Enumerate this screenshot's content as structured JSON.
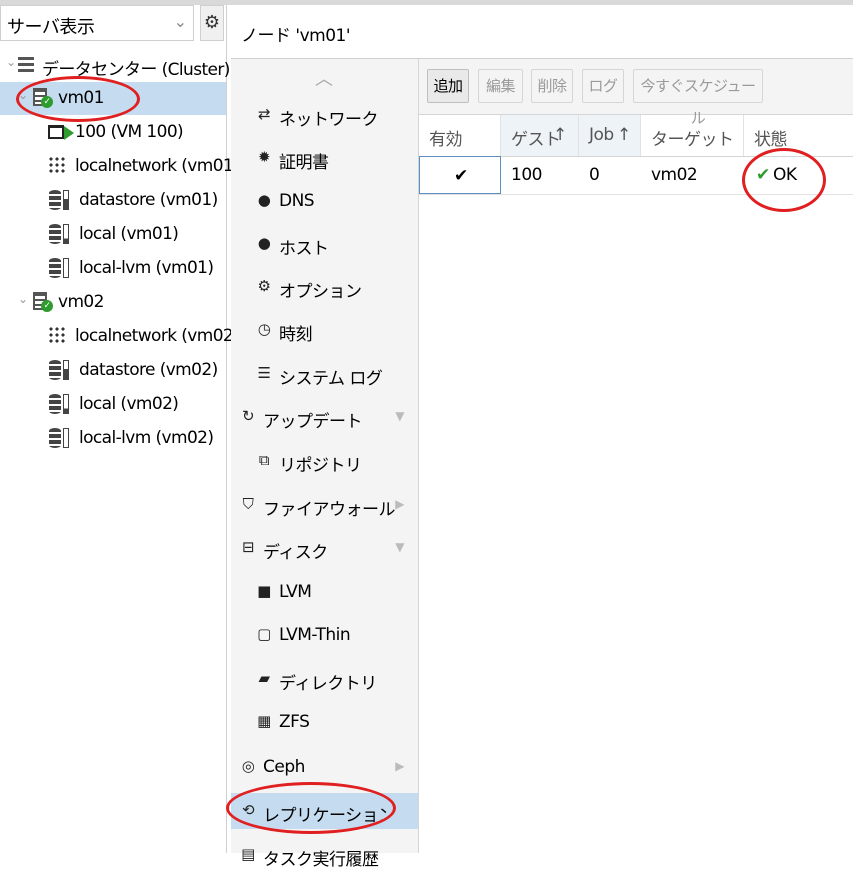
{
  "colors": {
    "selection": "#c5dcf0",
    "ok_green": "#2e9b2e",
    "annotation_red": "#e02020"
  },
  "view_selector": {
    "value": "サーバ表示"
  },
  "tree": {
    "datacenter": "データセンター (Cluster)",
    "vm01": {
      "label": "vm01",
      "children": [
        "100 (VM 100)",
        "localnetwork (vm01)",
        "datastore (vm01)",
        "local (vm01)",
        "local-lvm (vm01)"
      ]
    },
    "vm02": {
      "label": "vm02",
      "children": [
        "localnetwork (vm02)",
        "datastore (vm02)",
        "local (vm02)",
        "local-lvm (vm02)"
      ]
    }
  },
  "header": {
    "title": "ノード 'vm01'"
  },
  "nav": {
    "items": [
      {
        "icon": "exchange-icon",
        "label": "ネットワーク"
      },
      {
        "icon": "certificate-icon",
        "label": "証明書"
      },
      {
        "icon": "globe-icon",
        "label": "DNS"
      },
      {
        "icon": "globe-icon",
        "label": "ホスト"
      },
      {
        "icon": "gear-icon",
        "label": "オプション"
      },
      {
        "icon": "clock-icon",
        "label": "時刻"
      },
      {
        "icon": "list-icon",
        "label": "システム ログ"
      },
      {
        "icon": "refresh-icon",
        "label": "アップデート"
      },
      {
        "icon": "copy-icon",
        "label": "リポジトリ"
      },
      {
        "icon": "shield-icon",
        "label": "ファイアウォール"
      },
      {
        "icon": "hdd-icon",
        "label": "ディスク"
      },
      {
        "icon": "square-icon",
        "label": "LVM"
      },
      {
        "icon": "square-outline-icon",
        "label": "LVM-Thin"
      },
      {
        "icon": "folder-icon",
        "label": "ディレクトリ"
      },
      {
        "icon": "th-large-icon",
        "label": "ZFS"
      },
      {
        "icon": "ceph-icon",
        "label": "Ceph"
      },
      {
        "icon": "retweet-icon",
        "label": "レプリケーション"
      },
      {
        "icon": "list-alt-icon",
        "label": "タスク実行履歴"
      }
    ]
  },
  "toolbar": {
    "add": "追加",
    "edit": "編集",
    "remove": "削除",
    "log": "ログ",
    "schedule_now": "今すぐスケジュール"
  },
  "grid": {
    "columns": [
      "有効",
      "ゲスト",
      "Job",
      "ターゲット",
      "状態"
    ],
    "rows": [
      {
        "enabled": "✔",
        "guest": "100",
        "job": "0",
        "target": "vm02",
        "status": "OK"
      }
    ]
  }
}
